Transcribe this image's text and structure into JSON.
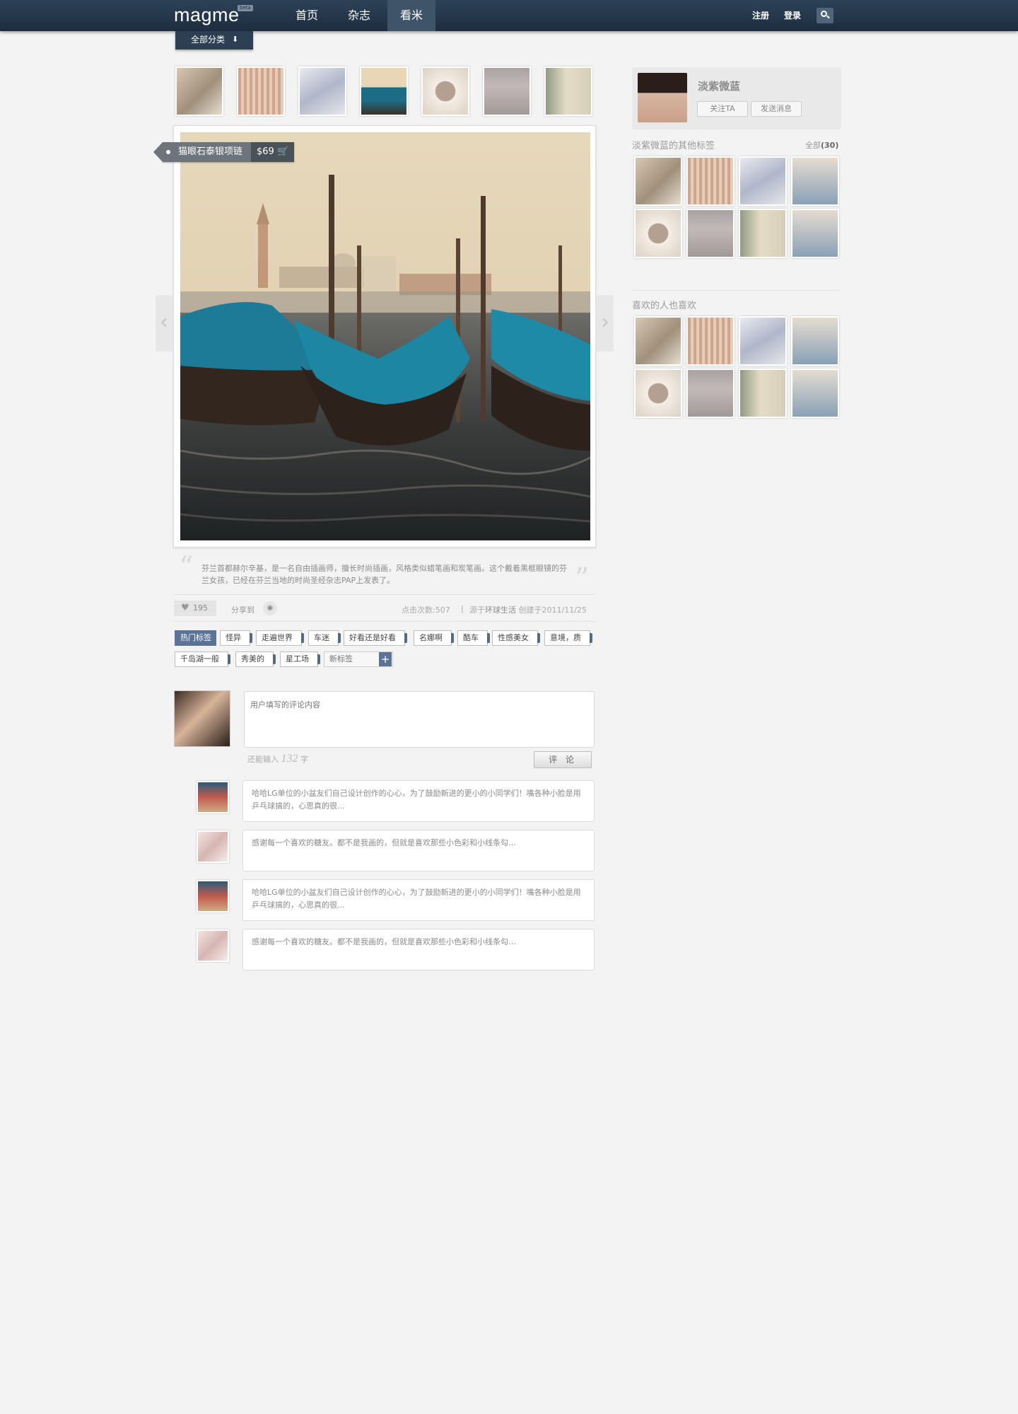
{
  "header": {
    "logo": "magme",
    "beta": "beta",
    "nav": [
      {
        "label": "首页"
      },
      {
        "label": "杂志"
      },
      {
        "label": "看米"
      }
    ],
    "register": "注册",
    "login": "登录",
    "category_dropdown": "全部分类"
  },
  "product": {
    "name": "猫眼石泰银项链",
    "price": "$69"
  },
  "description": "芬兰首都赫尔辛基，是一名自由插画师，擅长时尚插画，风格类似蜡笔画和炭笔画。这个戴着黑框眼镜的芬兰女孩，已经在芬兰当地的时尚圣经杂志PAP上发表了。",
  "stats": {
    "likes": "195",
    "share_label": "分享到",
    "views_label": "点击次数:",
    "views": "507",
    "source_prefix": "源于",
    "source": "环球生活",
    "created": "创建于2011/11/25"
  },
  "tags": {
    "hot_label": "热门标签",
    "items": [
      "怪异",
      "走遍世界",
      "车迷",
      "好看还是好看",
      "名娜啊",
      "酷车",
      "性感美女",
      "意境，质",
      "千岛湖一般",
      "秀美的",
      "星工场"
    ],
    "new_placeholder": "新标签",
    "add": "+"
  },
  "comment_form": {
    "placeholder": "用户填写的评论内容",
    "remain_prefix": "还能输入",
    "remain_count": "132",
    "remain_suffix": "字",
    "submit": "评 论"
  },
  "comments": [
    {
      "text": "哈哈LG单位的小盆友们自己设计创作的心心，为了鼓励新进的更小的小同学们！嘴各种小脸是用乒乓球搞的，心思真的很..."
    },
    {
      "text": "感谢每一个喜欢的糖友。都不是我画的，但就是喜欢那些小色彩和小线条勾…"
    },
    {
      "text": "哈哈LG单位的小盆友们自己设计创作的心心，为了鼓励新进的更小的小同学们！嘴各种小脸是用乒乓球搞的，心思真的很..."
    },
    {
      "text": "感谢每一个喜欢的糖友。都不是我画的，但就是喜欢那些小色彩和小线条勾…"
    }
  ],
  "sidebar": {
    "user_name": "淡紫微蓝",
    "follow": "关注TA",
    "message": "发送消息",
    "other_tags_title": "淡紫微蓝的其他标签",
    "all_label": "全部",
    "all_count": "(30)",
    "also_like_title": "喜欢的人也喜欢"
  }
}
